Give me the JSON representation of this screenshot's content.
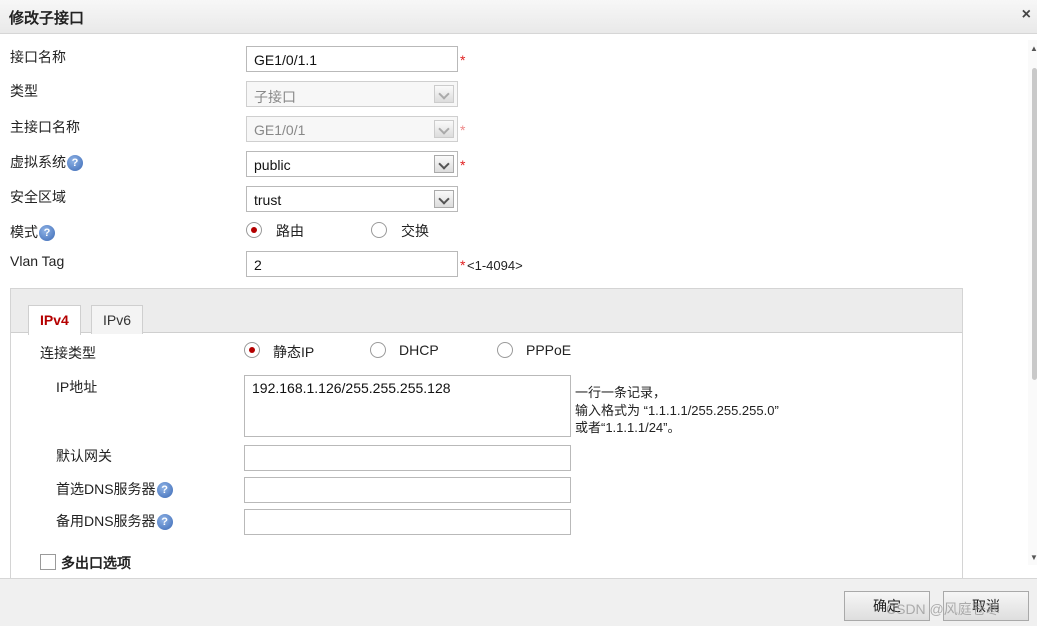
{
  "dialog": {
    "title": "修改子接口",
    "close": "×"
  },
  "form": {
    "interface_name": {
      "label": "接口名称",
      "value": "GE1/0/1.1",
      "required": "*"
    },
    "type": {
      "label": "类型",
      "value": "子接口"
    },
    "parent_interface": {
      "label": "主接口名称",
      "value": "GE1/0/1",
      "required": "*"
    },
    "vsys": {
      "label": "虚拟系统",
      "value": "public",
      "required": "*"
    },
    "zone": {
      "label": "安全区域",
      "value": "trust"
    },
    "mode": {
      "label": "模式",
      "options": [
        "路由",
        "交换"
      ],
      "selected": "路由"
    },
    "vlan_tag": {
      "label": "Vlan Tag",
      "value": "2",
      "required": "*",
      "range": "<1-4094>"
    }
  },
  "help_icon": "?",
  "tabs": [
    {
      "label": "IPv4",
      "active": true
    },
    {
      "label": "IPv6",
      "active": false
    }
  ],
  "ipv4": {
    "connection_type": {
      "label": "连接类型",
      "options": [
        "静态IP",
        "DHCP",
        "PPPoE"
      ],
      "selected": "静态IP"
    },
    "ip_address": {
      "label": "IP地址",
      "value": "192.168.1.126/255.255.255.128",
      "hint_lines": [
        "一行一条记录，",
        "输入格式为 “1.1.1.1/255.255.255.0”",
        "或者“1.1.1.1/24”。"
      ]
    },
    "gateway": {
      "label": "默认网关",
      "value": ""
    },
    "dns_primary": {
      "label": "首选DNS服务器",
      "value": ""
    },
    "dns_secondary": {
      "label": "备用DNS服务器",
      "value": ""
    },
    "multi_egress": {
      "label": "多出口选项",
      "checked": false
    }
  },
  "footer": {
    "ok_label": "确定",
    "cancel_label": "取消",
    "watermark": "CSDN @风庭苍寒"
  },
  "colors": {
    "accent_red": "#b50000",
    "required": "#e02020",
    "help_blue": "#3b69b5"
  }
}
